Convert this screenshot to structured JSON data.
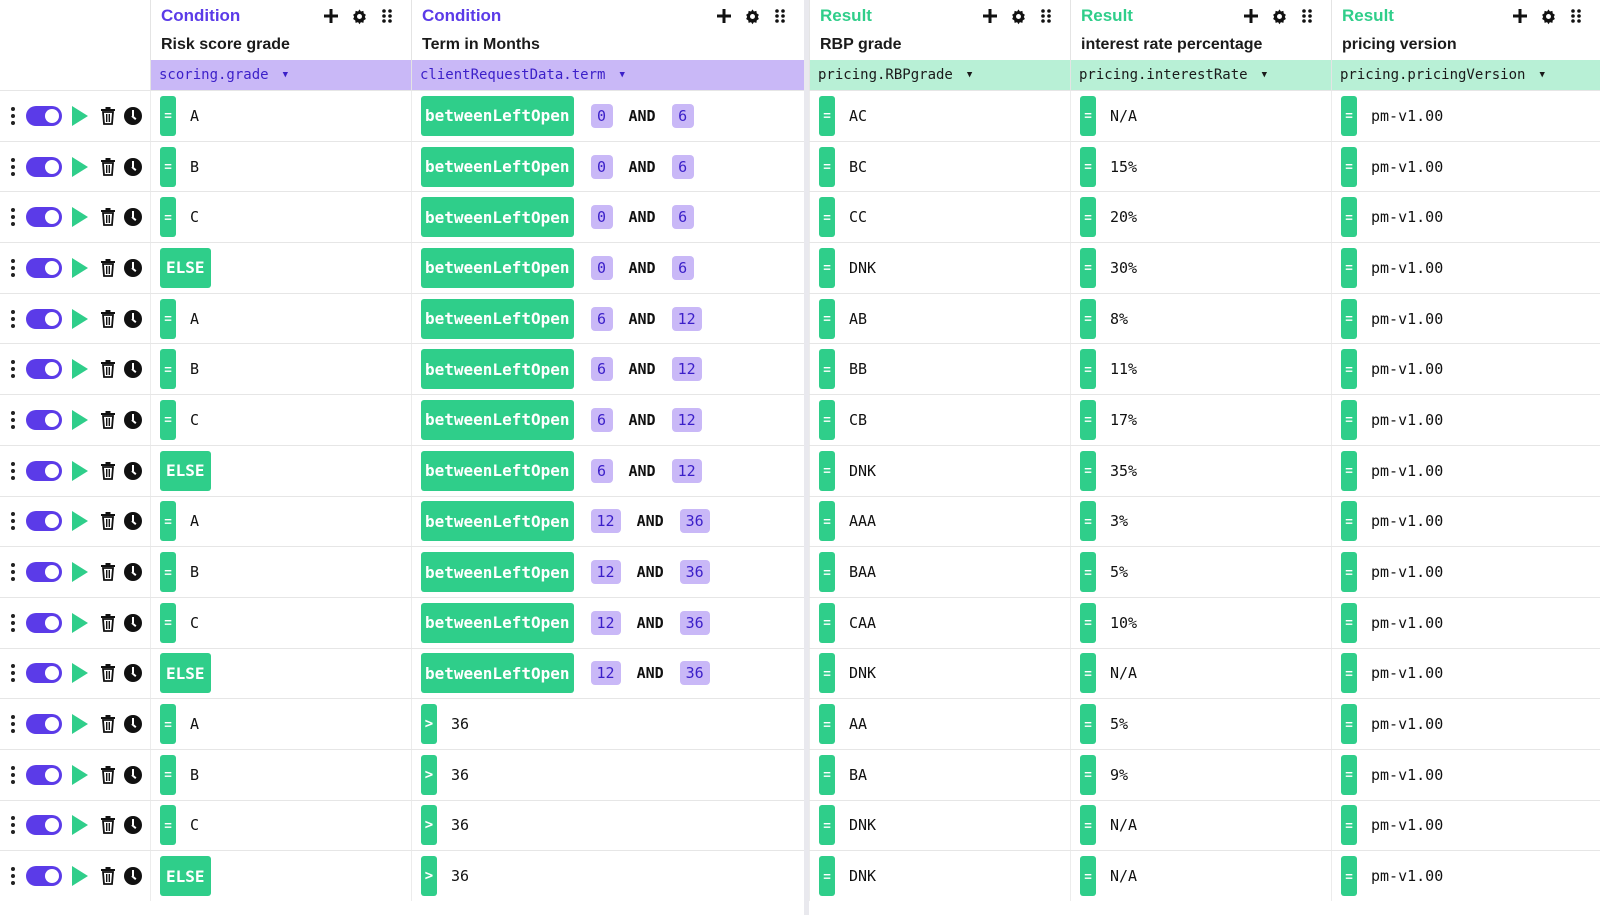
{
  "columns": [
    {
      "type": "Condition",
      "title": "Risk score grade",
      "path": "scoring.grade"
    },
    {
      "type": "Condition",
      "title": "Term in Months",
      "path": "clientRequestData.term"
    },
    {
      "type": "Result",
      "title": "RBP grade",
      "path": "pricing.RBPgrade"
    },
    {
      "type": "Result",
      "title": "interest rate percentage",
      "path": "pricing.interestRate"
    },
    {
      "type": "Result",
      "title": "pricing version",
      "path": "pricing.pricingVersion"
    }
  ],
  "labels": {
    "and": "AND",
    "eq": "=",
    "gt": ">",
    "else": "ELSE"
  },
  "rows": [
    {
      "grade": "A",
      "op": "betweenLeftOpen",
      "lo": "0",
      "hi": "6",
      "rbp": "AC",
      "rate": "N/A",
      "ver": "pm-v1.00"
    },
    {
      "grade": "B",
      "op": "betweenLeftOpen",
      "lo": "0",
      "hi": "6",
      "rbp": "BC",
      "rate": "15%",
      "ver": "pm-v1.00"
    },
    {
      "grade": "C",
      "op": "betweenLeftOpen",
      "lo": "0",
      "hi": "6",
      "rbp": "CC",
      "rate": "20%",
      "ver": "pm-v1.00"
    },
    {
      "grade": "ELSE",
      "op": "betweenLeftOpen",
      "lo": "0",
      "hi": "6",
      "rbp": "DNK",
      "rate": "30%",
      "ver": "pm-v1.00"
    },
    {
      "grade": "A",
      "op": "betweenLeftOpen",
      "lo": "6",
      "hi": "12",
      "rbp": "AB",
      "rate": "8%",
      "ver": "pm-v1.00"
    },
    {
      "grade": "B",
      "op": "betweenLeftOpen",
      "lo": "6",
      "hi": "12",
      "rbp": "BB",
      "rate": "11%",
      "ver": "pm-v1.00"
    },
    {
      "grade": "C",
      "op": "betweenLeftOpen",
      "lo": "6",
      "hi": "12",
      "rbp": "CB",
      "rate": "17%",
      "ver": "pm-v1.00"
    },
    {
      "grade": "ELSE",
      "op": "betweenLeftOpen",
      "lo": "6",
      "hi": "12",
      "rbp": "DNK",
      "rate": "35%",
      "ver": "pm-v1.00"
    },
    {
      "grade": "A",
      "op": "betweenLeftOpen",
      "lo": "12",
      "hi": "36",
      "rbp": "AAA",
      "rate": "3%",
      "ver": "pm-v1.00"
    },
    {
      "grade": "B",
      "op": "betweenLeftOpen",
      "lo": "12",
      "hi": "36",
      "rbp": "BAA",
      "rate": "5%",
      "ver": "pm-v1.00"
    },
    {
      "grade": "C",
      "op": "betweenLeftOpen",
      "lo": "12",
      "hi": "36",
      "rbp": "CAA",
      "rate": "10%",
      "ver": "pm-v1.00"
    },
    {
      "grade": "ELSE",
      "op": "betweenLeftOpen",
      "lo": "12",
      "hi": "36",
      "rbp": "DNK",
      "rate": "N/A",
      "ver": "pm-v1.00"
    },
    {
      "grade": "A",
      "op": ">",
      "value": "36",
      "rbp": "AA",
      "rate": "5%",
      "ver": "pm-v1.00"
    },
    {
      "grade": "B",
      "op": ">",
      "value": "36",
      "rbp": "BA",
      "rate": "9%",
      "ver": "pm-v1.00"
    },
    {
      "grade": "C",
      "op": ">",
      "value": "36",
      "rbp": "DNK",
      "rate": "N/A",
      "ver": "pm-v1.00"
    },
    {
      "grade": "ELSE",
      "op": ">",
      "value": "36",
      "rbp": "DNK",
      "rate": "N/A",
      "ver": "pm-v1.00"
    }
  ],
  "colors": {
    "condition": "#5b3be8",
    "result": "#2fce8a",
    "condition_path_bg": "#c9b8f7",
    "result_path_bg": "#b8f0d6"
  },
  "icons": {
    "row_controls": [
      "drag-handle-icon",
      "toggle",
      "play-icon",
      "trash-icon",
      "clock-icon"
    ],
    "header_actions": [
      "plus-icon",
      "gear-icon",
      "drag-grip-icon"
    ]
  }
}
